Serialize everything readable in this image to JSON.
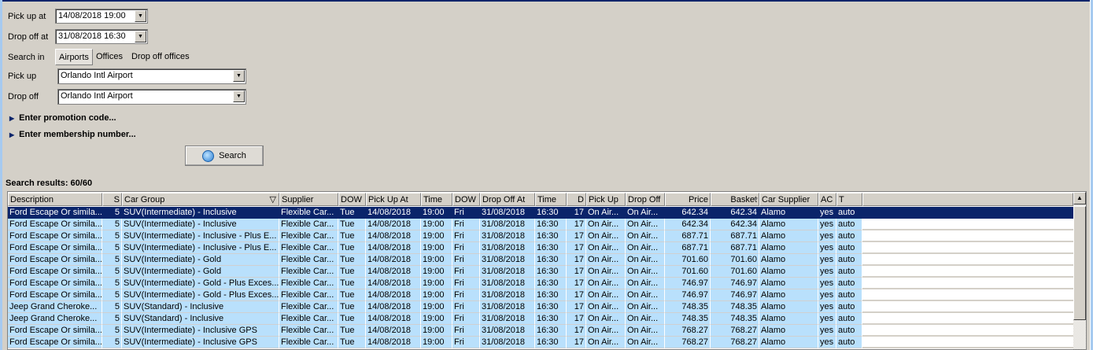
{
  "form": {
    "pickup_at_label": "Pick up at",
    "pickup_at_value": "14/08/2018 19:00",
    "dropoff_at_label": "Drop off at",
    "dropoff_at_value": "31/08/2018 16:30",
    "search_in_label": "Search in",
    "tabs": [
      "Airports",
      "Offices",
      "Drop off offices"
    ],
    "pickup_label": "Pick up",
    "pickup_value": "Orlando Intl Airport",
    "dropoff_label": "Drop off",
    "dropoff_value": "Orlando Intl Airport",
    "promo": "Enter promotion code...",
    "membership": "Enter membership number...",
    "search_button": "Search"
  },
  "results": {
    "title": "Search results: 60/60",
    "columns": [
      "Description",
      "S",
      "Car Group",
      "Supplier",
      "DOW",
      "Pick Up At",
      "Time",
      "DOW",
      "Drop Off At",
      "Time",
      "D",
      "Pick Up",
      "Drop Off",
      "Price",
      "Basket",
      "Car Supplier",
      "AC",
      "T"
    ],
    "rows": [
      [
        "Ford Escape Or simila...",
        "5",
        "SUV(Intermediate) - Inclusive",
        "Flexible Car...",
        "Tue",
        "14/08/2018",
        "19:00",
        "Fri",
        "31/08/2018",
        "16:30",
        "17",
        "On Air...",
        "On Air...",
        "642.34",
        "642.34",
        "Alamo",
        "yes",
        "auto"
      ],
      [
        "Ford Escape Or simila...",
        "5",
        "SUV(Intermediate) - Inclusive",
        "Flexible Car...",
        "Tue",
        "14/08/2018",
        "19:00",
        "Fri",
        "31/08/2018",
        "16:30",
        "17",
        "On Air...",
        "On Air...",
        "642.34",
        "642.34",
        "Alamo",
        "yes",
        "auto"
      ],
      [
        "Ford Escape Or simila...",
        "5",
        "SUV(Intermediate) - Inclusive - Plus E...",
        "Flexible Car...",
        "Tue",
        "14/08/2018",
        "19:00",
        "Fri",
        "31/08/2018",
        "16:30",
        "17",
        "On Air...",
        "On Air...",
        "687.71",
        "687.71",
        "Alamo",
        "yes",
        "auto"
      ],
      [
        "Ford Escape Or simila...",
        "5",
        "SUV(Intermediate) - Inclusive - Plus E...",
        "Flexible Car...",
        "Tue",
        "14/08/2018",
        "19:00",
        "Fri",
        "31/08/2018",
        "16:30",
        "17",
        "On Air...",
        "On Air...",
        "687.71",
        "687.71",
        "Alamo",
        "yes",
        "auto"
      ],
      [
        "Ford Escape Or simila...",
        "5",
        "SUV(Intermediate) - Gold",
        "Flexible Car...",
        "Tue",
        "14/08/2018",
        "19:00",
        "Fri",
        "31/08/2018",
        "16:30",
        "17",
        "On Air...",
        "On Air...",
        "701.60",
        "701.60",
        "Alamo",
        "yes",
        "auto"
      ],
      [
        "Ford Escape Or simila...",
        "5",
        "SUV(Intermediate) - Gold",
        "Flexible Car...",
        "Tue",
        "14/08/2018",
        "19:00",
        "Fri",
        "31/08/2018",
        "16:30",
        "17",
        "On Air...",
        "On Air...",
        "701.60",
        "701.60",
        "Alamo",
        "yes",
        "auto"
      ],
      [
        "Ford Escape Or simila...",
        "5",
        "SUV(Intermediate) - Gold - Plus Exces...",
        "Flexible Car...",
        "Tue",
        "14/08/2018",
        "19:00",
        "Fri",
        "31/08/2018",
        "16:30",
        "17",
        "On Air...",
        "On Air...",
        "746.97",
        "746.97",
        "Alamo",
        "yes",
        "auto"
      ],
      [
        "Ford Escape Or simila...",
        "5",
        "SUV(Intermediate) - Gold - Plus Exces...",
        "Flexible Car...",
        "Tue",
        "14/08/2018",
        "19:00",
        "Fri",
        "31/08/2018",
        "16:30",
        "17",
        "On Air...",
        "On Air...",
        "746.97",
        "746.97",
        "Alamo",
        "yes",
        "auto"
      ],
      [
        "Jeep Grand Cheroke...",
        "5",
        "SUV(Standard) - Inclusive",
        "Flexible Car...",
        "Tue",
        "14/08/2018",
        "19:00",
        "Fri",
        "31/08/2018",
        "16:30",
        "17",
        "On Air...",
        "On Air...",
        "748.35",
        "748.35",
        "Alamo",
        "yes",
        "auto"
      ],
      [
        "Jeep Grand Cheroke...",
        "5",
        "SUV(Standard) - Inclusive",
        "Flexible Car...",
        "Tue",
        "14/08/2018",
        "19:00",
        "Fri",
        "31/08/2018",
        "16:30",
        "17",
        "On Air...",
        "On Air...",
        "748.35",
        "748.35",
        "Alamo",
        "yes",
        "auto"
      ],
      [
        "Ford Escape Or simila...",
        "5",
        "SUV(Intermediate) - Inclusive GPS",
        "Flexible Car...",
        "Tue",
        "14/08/2018",
        "19:00",
        "Fri",
        "31/08/2018",
        "16:30",
        "17",
        "On Air...",
        "On Air...",
        "768.27",
        "768.27",
        "Alamo",
        "yes",
        "auto"
      ],
      [
        "Ford Escape Or simila...",
        "5",
        "SUV(Intermediate) - Inclusive GPS",
        "Flexible Car...",
        "Tue",
        "14/08/2018",
        "19:00",
        "Fri",
        "31/08/2018",
        "16:30",
        "17",
        "On Air...",
        "On Air...",
        "768.27",
        "768.27",
        "Alamo",
        "yes",
        "auto"
      ]
    ]
  },
  "colors": {
    "selected": "#0a246a",
    "row": "#b9e0fc"
  }
}
